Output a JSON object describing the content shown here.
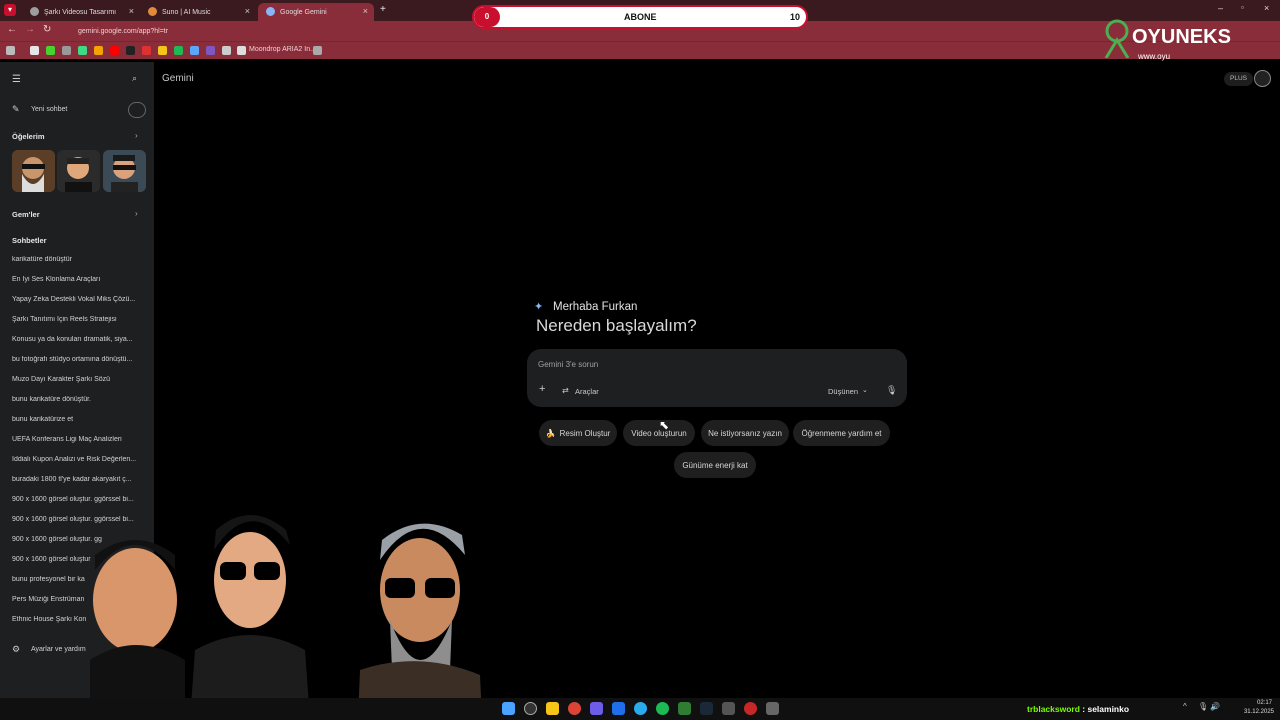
{
  "tabs": [
    {
      "title": "Şarkı Videosu Tasarımı",
      "favColor": "#9e9e9e"
    },
    {
      "title": "Suno | AI Music",
      "favColor": "#e08a3c"
    },
    {
      "title": "Google Gemini",
      "favColor": "#8ab4f8"
    }
  ],
  "address": {
    "url": "gemini.google.com/app?hl=tr"
  },
  "bookmarks": {
    "item": "Moondrop ARIA2 In..."
  },
  "overlay": {
    "abone_count": "0",
    "abone_label": "ABONE",
    "abone_goal": "10",
    "progress": 0,
    "brand": "OYUNEKS",
    "brand_url": "www.oyu"
  },
  "sidebar": {
    "new_chat": "Yeni sohbet",
    "items_header": "Öğelerim",
    "gems": "Gem'ler",
    "chats_header": "Sohbetler",
    "chats": [
      "karikatüre dönüştür",
      "En İyi Ses Klonlama Araçları",
      "Yapay Zeka Destekli Vokal Miks Çözü...",
      "Şarkı Tanıtımı İçin Reels Stratejisi",
      "Konusu ya da konuları dramatik, siya...",
      "bu fotoğrafı stüdyo ortamına dönüştü...",
      "Muzo Dayı Karakter Şarkı Sözü",
      "bunu karikatüre dönüştür.",
      "bunu karikatürize et",
      "UEFA Konferans Ligi Maç Analizleri",
      "İddialı Kupon Analizi ve Risk Değerlen...",
      "buradaki 1800 tl'ye kadar akaryakıt ç...",
      "900 x 1600 görsel oluştur. ggörssel bi...",
      "900 x 1600 görsel oluştur. ggörssel bi...",
      "900 x 1600 görsel oluştur. gg",
      "900 x 1600 görsel oluştur",
      "bunu profesyonel bir ka",
      "Pers Müziği Enstrüman",
      "Ethnic House Şarkı Kon"
    ],
    "settings": "Ayarlar ve yardım"
  },
  "main": {
    "app_title": "Gemini",
    "plus_badge": "PLUS",
    "greeting": "Merhaba Furkan",
    "headline": "Nereden başlayalım?",
    "input_placeholder": "Gemini 3'e sorun",
    "tools_label": "Araçlar",
    "mode_label": "Düşünen",
    "chips": [
      "Resim Oluştur",
      "Video oluşturun",
      "Ne istiyorsanız yazın",
      "Öğrenmeme yardım et",
      "Günüme enerji kat"
    ],
    "chip_emoji": "🍌"
  },
  "chat_overlay": {
    "user": "trblacksword",
    "message": "selaminko"
  },
  "clock": {
    "time": "02:17",
    "date": "31.12.2025"
  },
  "colors": {
    "chrome": "#8a2d3a",
    "tabbar": "#3b1a1f",
    "sidebar": "#1e1f20",
    "accent": "#8ab4f8",
    "abone_red": "#c8102e",
    "chat_user": "#7cfc00"
  }
}
